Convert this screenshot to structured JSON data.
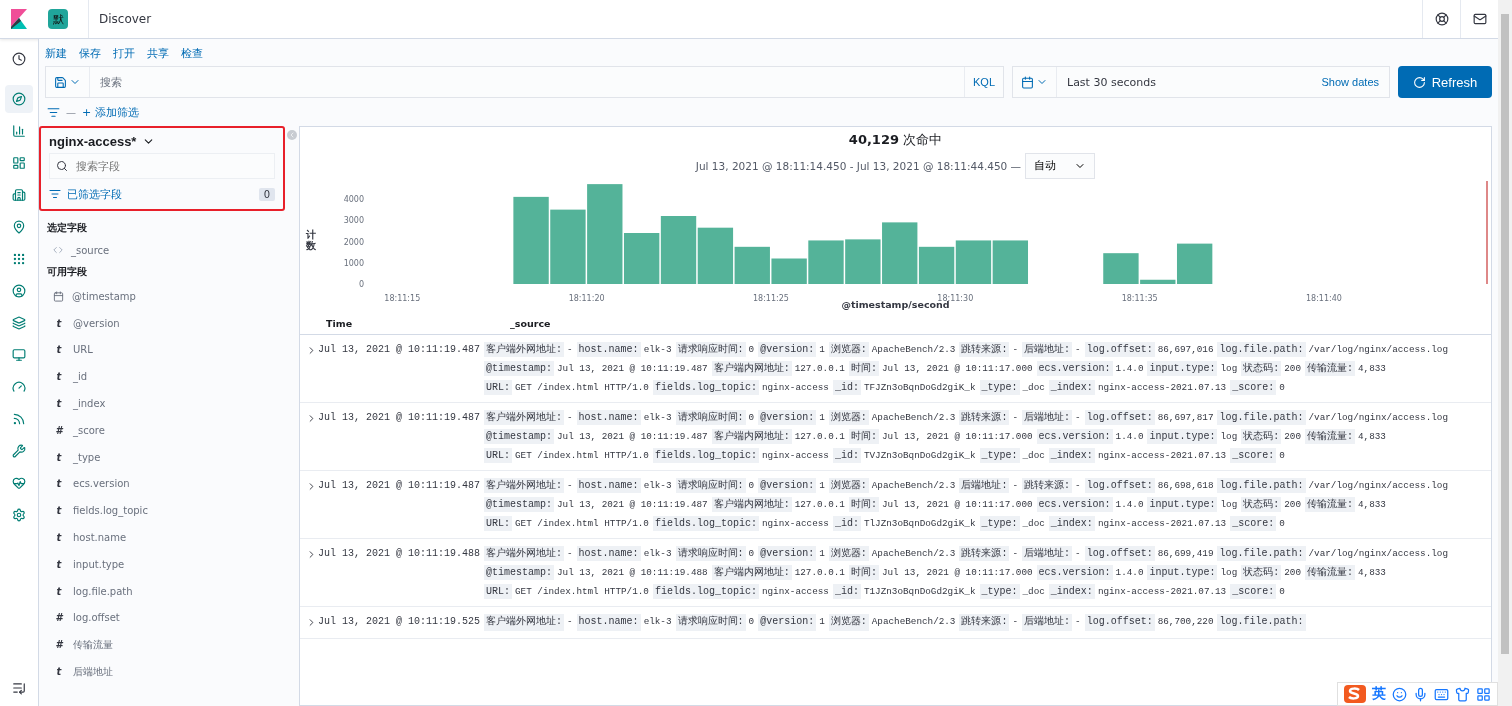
{
  "header": {
    "space_badge": "默",
    "breadcrumb": "Discover"
  },
  "nav": [
    {
      "selected": false
    },
    {
      "selected": true
    },
    {
      "selected": false
    },
    {
      "selected": false
    },
    {
      "selected": false
    },
    {
      "selected": false
    },
    {
      "selected": false
    },
    {
      "selected": false
    },
    {
      "selected": false
    },
    {
      "selected": false
    },
    {
      "selected": false
    },
    {
      "selected": false
    },
    {
      "selected": false
    },
    {
      "selected": false
    },
    {
      "selected": false
    }
  ],
  "top_menu": [
    "新建",
    "保存",
    "打开",
    "共享",
    "检查"
  ],
  "query_bar": {
    "placeholder": "搜索",
    "language": "KQL",
    "time_range": "Last 30 seconds",
    "show_dates": "Show dates",
    "refresh": "Refresh"
  },
  "filter_bar": {
    "separator": "—",
    "add_filter": "+ 添加筛选"
  },
  "sidebar": {
    "index_pattern": "nginx-access*",
    "highlighted": true,
    "search_placeholder": "搜索字段",
    "filtered_label": "已筛选字段",
    "filtered_count": "0",
    "selected_heading": "选定字段",
    "selected_fields": [
      {
        "kind": "source",
        "name": "_source"
      }
    ],
    "available_heading": "可用字段",
    "available_fields": [
      {
        "kind": "date",
        "name": "@timestamp"
      },
      {
        "kind": "text",
        "glyph": "t",
        "name": "@version"
      },
      {
        "kind": "text",
        "glyph": "t",
        "name": "URL"
      },
      {
        "kind": "text",
        "glyph": "t",
        "name": "_id"
      },
      {
        "kind": "text",
        "glyph": "t",
        "name": "_index"
      },
      {
        "kind": "text",
        "glyph": "#",
        "name": "_score"
      },
      {
        "kind": "text",
        "glyph": "t",
        "name": "_type"
      },
      {
        "kind": "text",
        "glyph": "t",
        "name": "ecs.version"
      },
      {
        "kind": "text",
        "glyph": "t",
        "name": "fields.log_topic"
      },
      {
        "kind": "text",
        "glyph": "t",
        "name": "host.name"
      },
      {
        "kind": "text",
        "glyph": "t",
        "name": "input.type"
      },
      {
        "kind": "text",
        "glyph": "t",
        "name": "log.file.path"
      },
      {
        "kind": "text",
        "glyph": "#",
        "name": "log.offset"
      },
      {
        "kind": "text",
        "glyph": "#",
        "name": "传输流量"
      },
      {
        "kind": "text",
        "glyph": "t",
        "name": "后端地址"
      }
    ]
  },
  "histogram": {
    "hits": "**40,129** 次命中",
    "range": "Jul 13, 2021 @ 18:11:14.450 - Jul 13, 2021 @ 18:11:44.450 —",
    "interval": "自动",
    "chart_data": {
      "type": "bar",
      "xlabel": "@timestamp/second",
      "ylabel": "计数",
      "categories": [
        "18:11:15",
        null,
        null,
        null,
        null,
        "18:11:20",
        null,
        null,
        null,
        null,
        "18:11:25",
        null,
        null,
        null,
        null,
        "18:11:30",
        null,
        null,
        null,
        null,
        "18:11:35",
        null,
        null,
        null,
        null,
        "18:11:40",
        null,
        null,
        null,
        null
      ],
      "ylim": [
        0,
        4800
      ],
      "values": [
        0,
        0,
        0,
        4100,
        3500,
        4700,
        2400,
        3200,
        2650,
        1750,
        1200,
        2050,
        2100,
        2900,
        1750,
        2050,
        2050,
        0,
        0,
        1450,
        200,
        1900,
        0,
        0,
        0,
        0,
        0,
        0,
        0,
        0
      ],
      "yticks": [
        0,
        1000,
        2000,
        3000,
        4000
      ]
    }
  },
  "documents": {
    "columns": [
      "Time",
      "_source"
    ],
    "rows": [
      {
        "time": "Jul 13, 2021 @ 10:11:19.487",
        "fields": [
          [
            "客户端外网地址:",
            "-"
          ],
          [
            "host.name:",
            "elk-3"
          ],
          [
            "请求响应时间:",
            "0"
          ],
          [
            "@version:",
            "1"
          ],
          [
            "浏览器:",
            "ApacheBench/2.3"
          ],
          [
            "跳转来源:",
            "-"
          ],
          [
            "后端地址:",
            "-"
          ],
          [
            "log.offset:",
            "86,697,016"
          ],
          [
            "log.file.path:",
            "/var/log/nginx/access.log"
          ],
          [
            "@timestamp:",
            "Jul 13, 2021 @ 10:11:19.487"
          ],
          [
            "客户端内网地址:",
            "127.0.0.1"
          ],
          [
            "时间:",
            "Jul 13, 2021 @ 10:11:17.000"
          ],
          [
            "ecs.version:",
            "1.4.0"
          ],
          [
            "input.type:",
            "log"
          ],
          [
            "状态码:",
            "200"
          ],
          [
            "传输流量:",
            "4,833"
          ],
          [
            "URL:",
            "GET /index.html HTTP/1.0"
          ],
          [
            "fields.log_topic:",
            "nginx-access"
          ],
          [
            "_id:",
            "TFJZn3oBqnDoGd2giK_k"
          ],
          [
            "_type:",
            "_doc"
          ],
          [
            "_index:",
            "nginx-access-2021.07.13"
          ],
          [
            "_score:",
            "0"
          ]
        ]
      },
      {
        "time": "Jul 13, 2021 @ 10:11:19.487",
        "fields": [
          [
            "客户端外网地址:",
            "-"
          ],
          [
            "host.name:",
            "elk-3"
          ],
          [
            "请求响应时间:",
            "0"
          ],
          [
            "@version:",
            "1"
          ],
          [
            "浏览器:",
            "ApacheBench/2.3"
          ],
          [
            "跳转来源:",
            "-"
          ],
          [
            "后端地址:",
            "-"
          ],
          [
            "log.offset:",
            "86,697,817"
          ],
          [
            "log.file.path:",
            "/var/log/nginx/access.log"
          ],
          [
            "@timestamp:",
            "Jul 13, 2021 @ 10:11:19.487"
          ],
          [
            "客户端内网地址:",
            "127.0.0.1"
          ],
          [
            "时间:",
            "Jul 13, 2021 @ 10:11:17.000"
          ],
          [
            "ecs.version:",
            "1.4.0"
          ],
          [
            "input.type:",
            "log"
          ],
          [
            "状态码:",
            "200"
          ],
          [
            "传输流量:",
            "4,833"
          ],
          [
            "URL:",
            "GET /index.html HTTP/1.0"
          ],
          [
            "fields.log_topic:",
            "nginx-access"
          ],
          [
            "_id:",
            "TVJZn3oBqnDoGd2giK_k"
          ],
          [
            "_type:",
            "_doc"
          ],
          [
            "_index:",
            "nginx-access-2021.07.13"
          ],
          [
            "_score:",
            "0"
          ]
        ]
      },
      {
        "time": "Jul 13, 2021 @ 10:11:19.487",
        "fields": [
          [
            "客户端外网地址:",
            "-"
          ],
          [
            "host.name:",
            "elk-3"
          ],
          [
            "请求响应时间:",
            "0"
          ],
          [
            "@version:",
            "1"
          ],
          [
            "浏览器:",
            "ApacheBench/2.3"
          ],
          [
            "后端地址:",
            "-"
          ],
          [
            "跳转来源:",
            "-"
          ],
          [
            "log.offset:",
            "86,698,618"
          ],
          [
            "log.file.path:",
            "/var/log/nginx/access.log"
          ],
          [
            "@timestamp:",
            "Jul 13, 2021 @ 10:11:19.487"
          ],
          [
            "客户端内网地址:",
            "127.0.0.1"
          ],
          [
            "时间:",
            "Jul 13, 2021 @ 10:11:17.000"
          ],
          [
            "ecs.version:",
            "1.4.0"
          ],
          [
            "input.type:",
            "log"
          ],
          [
            "状态码:",
            "200"
          ],
          [
            "传输流量:",
            "4,833"
          ],
          [
            "URL:",
            "GET /index.html HTTP/1.0"
          ],
          [
            "fields.log_topic:",
            "nginx-access"
          ],
          [
            "_id:",
            "TlJZn3oBqnDoGd2giK_k"
          ],
          [
            "_type:",
            "_doc"
          ],
          [
            "_index:",
            "nginx-access-2021.07.13"
          ],
          [
            "_score:",
            "0"
          ]
        ]
      },
      {
        "time": "Jul 13, 2021 @ 10:11:19.488",
        "fields": [
          [
            "客户端外网地址:",
            "-"
          ],
          [
            "host.name:",
            "elk-3"
          ],
          [
            "请求响应时间:",
            "0"
          ],
          [
            "@version:",
            "1"
          ],
          [
            "浏览器:",
            "ApacheBench/2.3"
          ],
          [
            "跳转来源:",
            "-"
          ],
          [
            "后端地址:",
            "-"
          ],
          [
            "log.offset:",
            "86,699,419"
          ],
          [
            "log.file.path:",
            "/var/log/nginx/access.log"
          ],
          [
            "@timestamp:",
            "Jul 13, 2021 @ 10:11:19.488"
          ],
          [
            "客户端内网地址:",
            "127.0.0.1"
          ],
          [
            "时间:",
            "Jul 13, 2021 @ 10:11:17.000"
          ],
          [
            "ecs.version:",
            "1.4.0"
          ],
          [
            "input.type:",
            "log"
          ],
          [
            "状态码:",
            "200"
          ],
          [
            "传输流量:",
            "4,833"
          ],
          [
            "URL:",
            "GET /index.html HTTP/1.0"
          ],
          [
            "fields.log_topic:",
            "nginx-access"
          ],
          [
            "_id:",
            "T1JZn3oBqnDoGd2giK_k"
          ],
          [
            "_type:",
            "_doc"
          ],
          [
            "_index:",
            "nginx-access-2021.07.13"
          ],
          [
            "_score:",
            "0"
          ]
        ]
      },
      {
        "time": "Jul 13, 2021 @ 10:11:19.525",
        "fields": [
          [
            "客户端外网地址:",
            "-"
          ],
          [
            "host.name:",
            "elk-3"
          ],
          [
            "请求响应时间:",
            "0"
          ],
          [
            "@version:",
            "1"
          ],
          [
            "浏览器:",
            "ApacheBench/2.3"
          ],
          [
            "跳转来源:",
            "-"
          ],
          [
            "后端地址:",
            "-"
          ],
          [
            "log.offset:",
            "86,700,220"
          ],
          [
            "log.file.path:"
          ]
        ]
      }
    ]
  },
  "ime_toolbar": {
    "mode": "英"
  }
}
